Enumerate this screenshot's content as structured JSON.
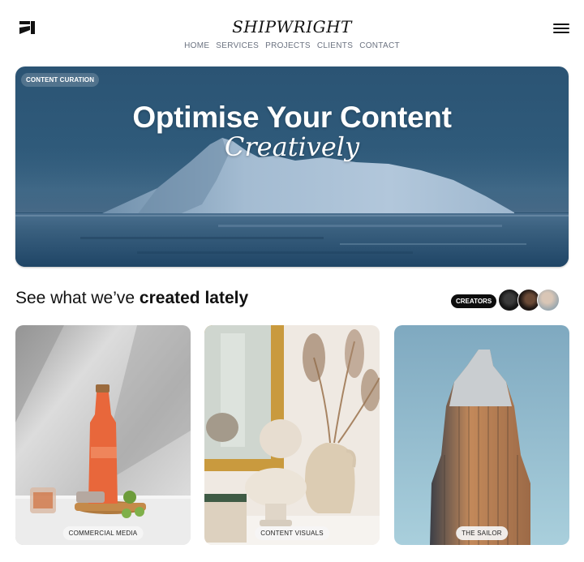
{
  "header": {
    "brand": "SHIPWRIGHT",
    "nav": [
      "HOME",
      "SERVICES",
      "PROJECTS",
      "CLIENTS",
      "CONTACT"
    ],
    "logo_icon": "brand-logo-icon",
    "menu_icon": "hamburger-menu-icon"
  },
  "hero": {
    "badge": "CONTENT CURATION",
    "title": "Optimise Your Content",
    "subtitle": "Creatively",
    "colors": {
      "primary": "#2b5474",
      "highlight": "#a9c0d6"
    }
  },
  "section": {
    "title_regular": "See what we’ve ",
    "title_bold": "created lately",
    "creators_label": "CREATORS",
    "avatars": [
      "creator-avatar-1",
      "creator-avatar-2",
      "creator-avatar-3"
    ]
  },
  "cards": [
    {
      "label": "COMMERCIAL MEDIA",
      "image": "product-bottle-photo"
    },
    {
      "label": "CONTENT VISUALS",
      "image": "interior-bust-photo"
    },
    {
      "label": "THE SAILOR",
      "image": "skyscraper-photo"
    }
  ]
}
